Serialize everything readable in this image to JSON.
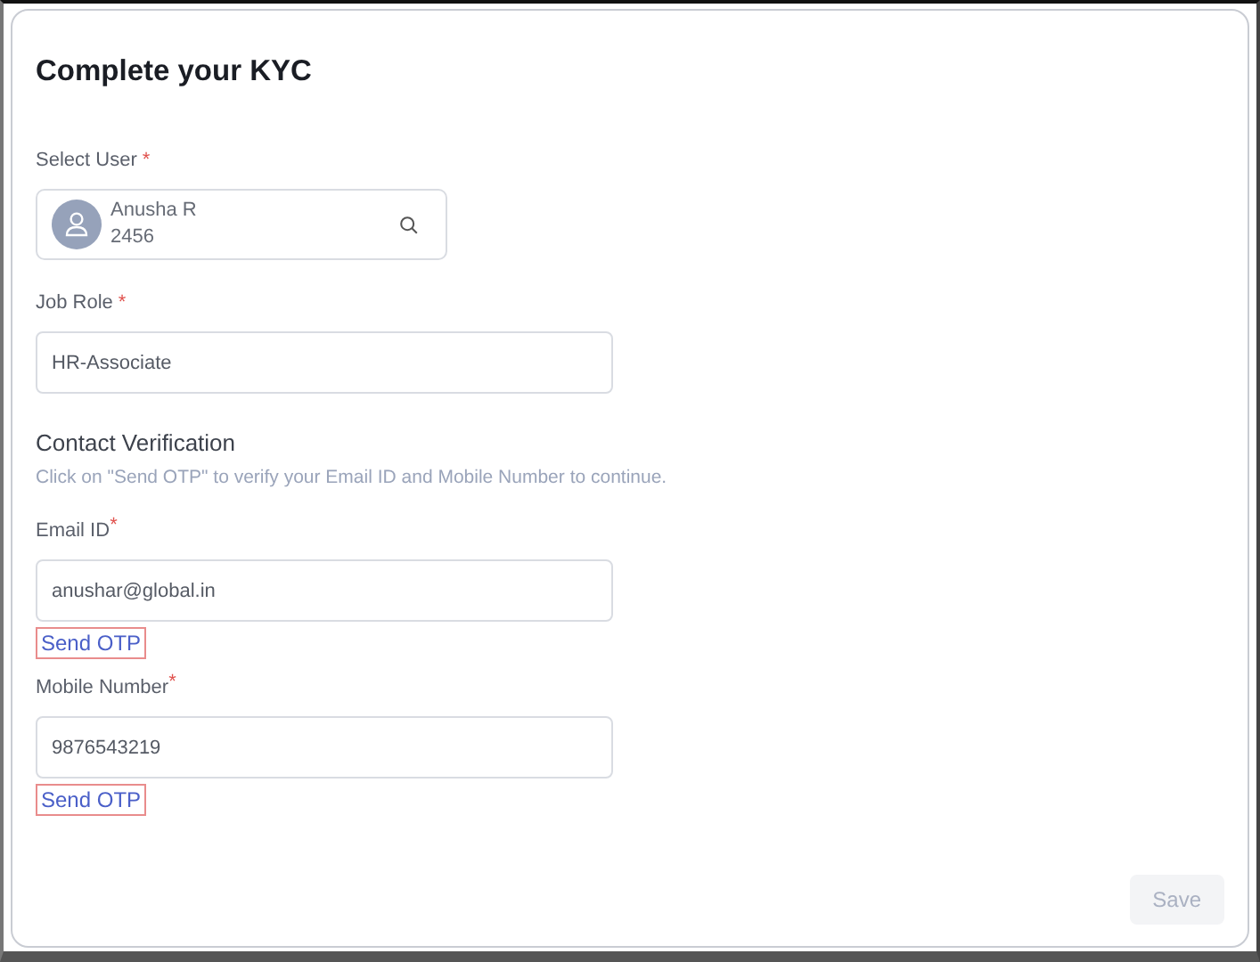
{
  "title": "Complete your KYC",
  "select_user": {
    "label": "Select User",
    "required_mark": "*",
    "name": "Anusha R",
    "id": "2456"
  },
  "job_role": {
    "label": "Job Role",
    "required_mark": "*",
    "value": "HR-Associate"
  },
  "contact_verification": {
    "heading": "Contact Verification",
    "hint": "Click on \"Send OTP\" to verify your Email ID and Mobile Number to continue.",
    "fields": [
      {
        "label": "Email ID",
        "required_mark": "*",
        "value": "anushar@global.in",
        "link": "Send OTP",
        "highlighted": true
      },
      {
        "label": "Mobile Number",
        "required_mark": "*",
        "value": "9876543219",
        "link": "Send OTP",
        "highlighted": true
      }
    ]
  },
  "save_button": {
    "label": "Save",
    "disabled": true
  }
}
